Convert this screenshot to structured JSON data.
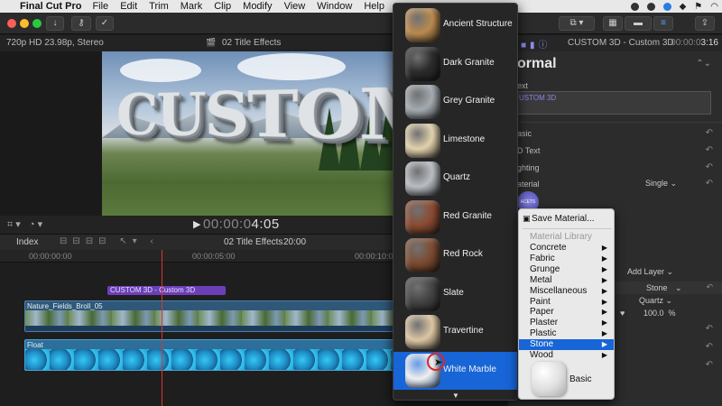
{
  "menubar": {
    "apple": "",
    "app_name": "Final Cut Pro",
    "items": [
      "File",
      "Edit",
      "Trim",
      "Mark",
      "Clip",
      "Modify",
      "View",
      "Window",
      "Help"
    ]
  },
  "viewer": {
    "format": "720p HD 23.98p, Stereo",
    "clip_name": "02 Title Effects",
    "title_text": "CUSTOM 3D",
    "timecode_dim": "00:00:0",
    "timecode_bright": "4:05"
  },
  "timeline": {
    "index_label": "Index",
    "project_name": "02 Title Effects",
    "duration": "20:00",
    "ruler": [
      "00:00:00:00",
      "00:00:05:00",
      "00:00:10:00"
    ],
    "title_clip": "CUSTOM 3D - Custom 3D",
    "video_clip": "Nature_Fields_Broll_05",
    "float_clip": "Float"
  },
  "inspector": {
    "clip_name": "CUSTOM 3D - Custom 3D",
    "timecode_dim": "00:00:0",
    "timecode_bright": "3:16",
    "preset": "ormal",
    "text_section": "ext",
    "text_value": "USTOM 3D",
    "basic": "asic",
    "text3d": "D Text",
    "lighting": "ghting",
    "material": "aterial",
    "material_mode": "Single",
    "facets": "ACETS",
    "add_layer": "Add Layer",
    "stone": "Stone",
    "quartz": "Quartz",
    "percent": "100.0",
    "percent_unit": "%"
  },
  "picker": {
    "materials": [
      {
        "label": "Ancient Structure",
        "color": "#b9894e"
      },
      {
        "label": "Dark Granite",
        "color": "#2b2b2b"
      },
      {
        "label": "Grey Granite",
        "color": "#a3aab0"
      },
      {
        "label": "Limestone",
        "color": "#e1d1ad"
      },
      {
        "label": "Quartz",
        "color": "#b8bcc3"
      },
      {
        "label": "Red Granite",
        "color": "#8a4a30"
      },
      {
        "label": "Red Rock",
        "color": "#7b4a30"
      },
      {
        "label": "Slate",
        "color": "#434343"
      },
      {
        "label": "Travertine",
        "color": "#dcc5a2"
      },
      {
        "label": "White Marble",
        "color": "#efefef"
      }
    ],
    "selected": "White Marble",
    "more": "▼"
  },
  "context_menu": {
    "save": "Save Material...",
    "library_header": "Material Library",
    "items": [
      "Concrete",
      "Fabric",
      "Grunge",
      "Metal",
      "Miscellaneous",
      "Paint",
      "Paper",
      "Plaster",
      "Plastic",
      "Stone",
      "Wood"
    ],
    "active": "Stone",
    "basic_label": "Basic"
  }
}
